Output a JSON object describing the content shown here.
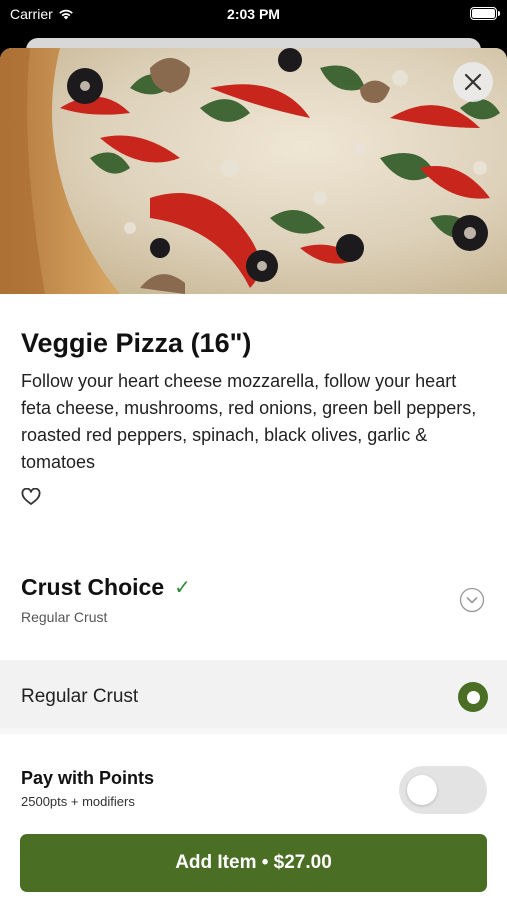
{
  "status_bar": {
    "carrier": "Carrier",
    "time": "2:03 PM",
    "wifi_icon": "wifi-icon",
    "battery_icon": "battery-icon"
  },
  "item": {
    "image_icon": "veggie-pizza-photo",
    "title": "Veggie Pizza (16\")",
    "description": "Follow your heart cheese mozzarella, follow your heart feta cheese, mushrooms, red onions, green bell peppers, roasted red peppers, spinach, black olives, garlic & tomatoes",
    "favorite_icon": "heart-icon",
    "close_icon": "close-icon"
  },
  "crust": {
    "title": "Crust Choice",
    "check_mark": "✓",
    "selected": "Regular Crust",
    "expand_icon": "chevron-down-icon",
    "options": [
      {
        "label": "Regular Crust",
        "selected": true
      }
    ]
  },
  "points": {
    "title": "Pay with Points",
    "subtitle": "2500pts + modifiers",
    "enabled": false
  },
  "add_button": {
    "label": "Add Item • $27.00"
  },
  "colors": {
    "accent": "#4a6e24",
    "check": "#2e8b3a"
  }
}
